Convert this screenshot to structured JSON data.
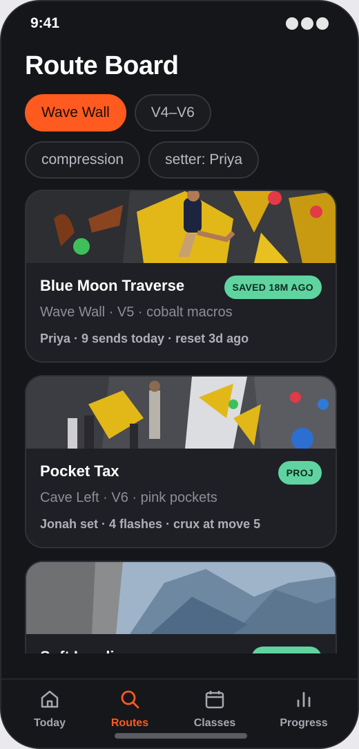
{
  "status": {
    "time": "9:41"
  },
  "page": {
    "title": "Route Board"
  },
  "filters": [
    "Wave Wall",
    "V4–V6",
    "compression",
    "setter: Priya"
  ],
  "routes": [
    {
      "title": "Blue Moon Traverse",
      "badge": "SAVED 18M AGO",
      "subtitle": "Wave Wall · V5 · cobalt macros",
      "meta": "Priya · 9 sends today · reset 3d ago"
    },
    {
      "title": "Pocket Tax",
      "badge": "PROJ",
      "subtitle": "Cave Left · V6 · pink pockets",
      "meta": "Jonah set · 4 flashes · crux at move 5"
    },
    {
      "title": "Soft Landing",
      "badge": "",
      "subtitle": "",
      "meta": ""
    }
  ],
  "tabs": [
    {
      "label": "Today",
      "icon": "home-icon"
    },
    {
      "label": "Routes",
      "icon": "search-icon"
    },
    {
      "label": "Classes",
      "icon": "calendar-icon"
    },
    {
      "label": "Progress",
      "icon": "bar-chart-icon"
    }
  ],
  "colors": {
    "accent": "#ff5a1f",
    "badge": "#5fd4a0",
    "background": "#151619"
  }
}
